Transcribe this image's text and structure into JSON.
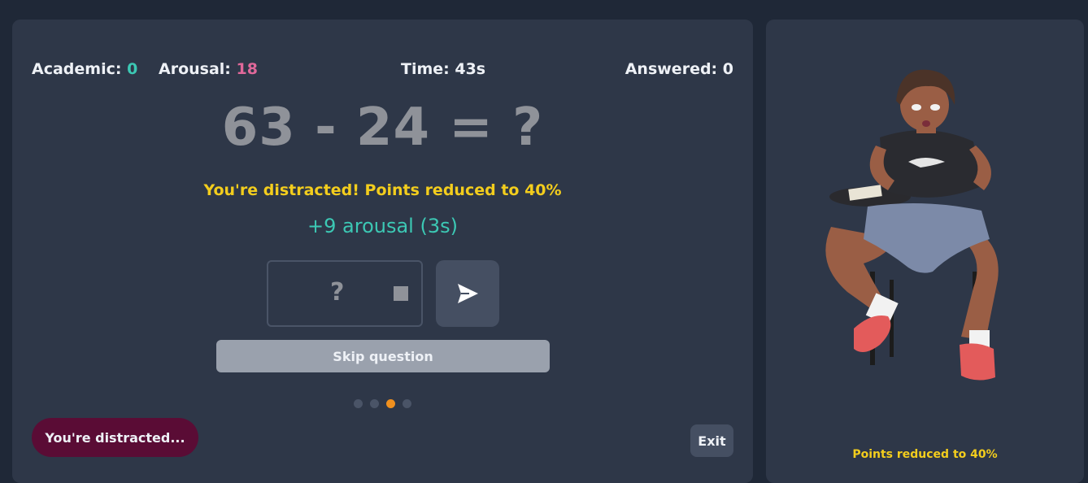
{
  "stats": {
    "academic_label": "Academic:",
    "academic_value": "0",
    "arousal_label": "Arousal:",
    "arousal_value": "18",
    "time": "Time: 43s",
    "answered": "Answered: 0"
  },
  "question": {
    "text": "63 - 24 = ?",
    "distract_message": "You're distracted! Points reduced to 40%",
    "arousal_gain": "+9 arousal (3s)"
  },
  "answer": {
    "placeholder": "?",
    "value": ""
  },
  "buttons": {
    "submit_icon": "send-icon",
    "skip": "Skip question",
    "exit": "Exit"
  },
  "progress_dots": {
    "count": 4,
    "active_index": 2
  },
  "status_pill": "You're distracted...",
  "side_panel": {
    "image": "seated-character-illustration",
    "status": "Points reduced to 40%"
  },
  "colors": {
    "teal": "#3cc8b4",
    "pink": "#e0689a",
    "warning_yellow": "#f3cd1d",
    "active_dot": "#f0901e",
    "pill_bg": "#5a0c35"
  }
}
